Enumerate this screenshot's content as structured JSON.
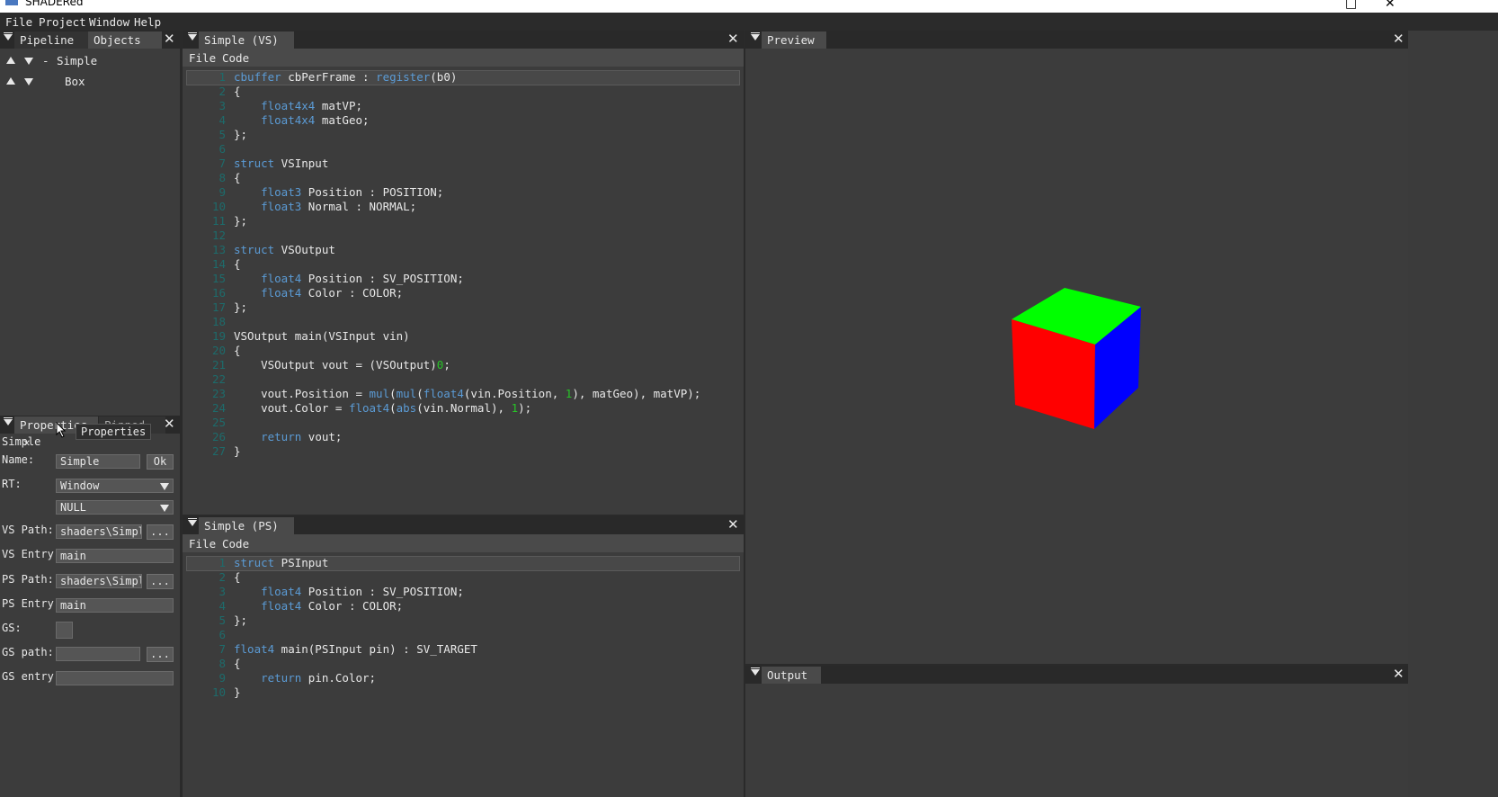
{
  "window": {
    "title": "SHADERed",
    "maximize_glyph": "□",
    "close_glyph": "✕"
  },
  "menubar": {
    "items": [
      "File",
      "Project",
      "Window",
      "Help"
    ]
  },
  "left_top_panel": {
    "tabs": [
      "Pipeline",
      "Objects"
    ],
    "items": [
      {
        "prefix": "-",
        "label": "Simple"
      },
      {
        "prefix": "",
        "label": "Box"
      }
    ]
  },
  "left_bottom_panel": {
    "tabs": [
      "Properties",
      "Pinned"
    ],
    "tab_close_glyph": "✕",
    "tooltip": "Properties",
    "header": "Simple",
    "fields": {
      "name_label": "Name:",
      "name_value": "Simple",
      "ok_label": "Ok",
      "rt_label": "RT:",
      "rt_value1": "Window",
      "rt_value2": "NULL",
      "vs_path_label": "VS Path:",
      "vs_path_value": "shaders\\Simple",
      "vs_entry_label": "VS Entry",
      "vs_entry_value": "main",
      "ps_path_label": "PS Path:",
      "ps_path_value": "shaders\\Simple",
      "ps_entry_label": "PS Entry",
      "ps_entry_value": "main",
      "gs_label": "GS:",
      "gs_path_label": "GS path:",
      "gs_path_value": "",
      "gs_entry_label": "GS entry",
      "gs_entry_value": "",
      "browse_label": "..."
    }
  },
  "vs_editor": {
    "title": "Simple (VS)",
    "menu": [
      "File",
      "Code"
    ],
    "lines": [
      "cbuffer cbPerFrame : register(b0)",
      "{",
      "    float4x4 matVP;",
      "    float4x4 matGeo;",
      "};",
      "",
      "struct VSInput",
      "{",
      "    float3 Position : POSITION;",
      "    float3 Normal : NORMAL;",
      "};",
      "",
      "struct VSOutput",
      "{",
      "    float4 Position : SV_POSITION;",
      "    float4 Color : COLOR;",
      "};",
      "",
      "VSOutput main(VSInput vin)",
      "{",
      "    VSOutput vout = (VSOutput)0;",
      "",
      "    vout.Position = mul(mul(float4(vin.Position, 1), matGeo), matVP);",
      "    vout.Color = float4(abs(vin.Normal), 1);",
      "",
      "    return vout;",
      "}"
    ]
  },
  "ps_editor": {
    "title": "Simple (PS)",
    "menu": [
      "File",
      "Code"
    ],
    "lines": [
      "struct PSInput",
      "{",
      "    float4 Position : SV_POSITION;",
      "    float4 Color : COLOR;",
      "};",
      "",
      "float4 main(PSInput pin) : SV_TARGET",
      "{",
      "    return pin.Color;",
      "}"
    ]
  },
  "preview": {
    "title": "Preview",
    "cube_colors": {
      "top": "#00ff00",
      "front": "#ff0000",
      "side": "#0000ff"
    }
  },
  "output": {
    "title": "Output"
  },
  "colors": {
    "keyword": "#5b9bd5",
    "number": "#27c427",
    "line_number": "#1d6b6b"
  }
}
